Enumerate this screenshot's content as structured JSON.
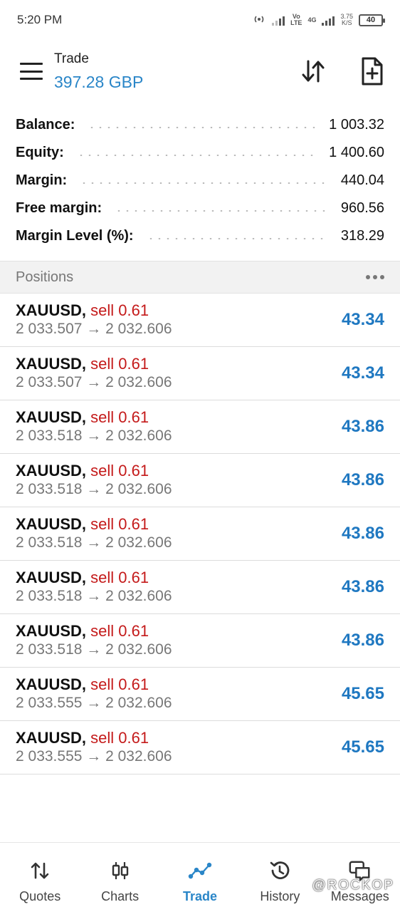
{
  "status_bar": {
    "time": "5:20 PM",
    "network_label_1": "Vo",
    "network_label_1b": "LTE",
    "network_label_2": "4G",
    "speed_value": "3.75",
    "speed_unit": "K/S",
    "battery": "40"
  },
  "header": {
    "title": "Trade",
    "value": "397.28 GBP",
    "menu_icon": "hamburger-icon",
    "sort_icon": "sort-arrows-icon",
    "new_order_icon": "new-document-icon",
    "accent_color": "#2a86c8"
  },
  "summary": [
    {
      "label": "Balance:",
      "value": "1 003.32"
    },
    {
      "label": "Equity:",
      "value": "1 400.60"
    },
    {
      "label": "Margin:",
      "value": "440.04"
    },
    {
      "label": "Free margin:",
      "value": "960.56"
    },
    {
      "label": "Margin Level (%):",
      "value": "318.29"
    }
  ],
  "positions": {
    "title": "Positions",
    "more_icon": "more-dots-icon",
    "items": [
      {
        "symbol": "XAUUSD,",
        "side": "sell 0.61",
        "prices": "2 033.507 → 2 032.606",
        "profit": "43.34"
      },
      {
        "symbol": "XAUUSD,",
        "side": "sell 0.61",
        "prices": "2 033.507 → 2 032.606",
        "profit": "43.34"
      },
      {
        "symbol": "XAUUSD,",
        "side": "sell 0.61",
        "prices": "2 033.518 → 2 032.606",
        "profit": "43.86"
      },
      {
        "symbol": "XAUUSD,",
        "side": "sell 0.61",
        "prices": "2 033.518 → 2 032.606",
        "profit": "43.86"
      },
      {
        "symbol": "XAUUSD,",
        "side": "sell 0.61",
        "prices": "2 033.518 → 2 032.606",
        "profit": "43.86"
      },
      {
        "symbol": "XAUUSD,",
        "side": "sell 0.61",
        "prices": "2 033.518 → 2 032.606",
        "profit": "43.86"
      },
      {
        "symbol": "XAUUSD,",
        "side": "sell 0.61",
        "prices": "2 033.518 → 2 032.606",
        "profit": "43.86"
      },
      {
        "symbol": "XAUUSD,",
        "side": "sell 0.61",
        "prices": "2 033.555 → 2 032.606",
        "profit": "45.65"
      },
      {
        "symbol": "XAUUSD,",
        "side": "sell 0.61",
        "prices": "2 033.555 → 2 032.606",
        "profit": "45.65"
      }
    ],
    "sell_color": "#c41a1a",
    "profit_color": "#1f78c1"
  },
  "bottom_nav": {
    "items": [
      {
        "label": "Quotes",
        "icon": "quotes-arrows-icon"
      },
      {
        "label": "Charts",
        "icon": "candlestick-icon"
      },
      {
        "label": "Trade",
        "icon": "trade-line-icon",
        "active": true
      },
      {
        "label": "History",
        "icon": "history-clock-icon"
      },
      {
        "label": "Messages",
        "icon": "messages-icon"
      }
    ],
    "watermark": "@ROCKOP"
  }
}
